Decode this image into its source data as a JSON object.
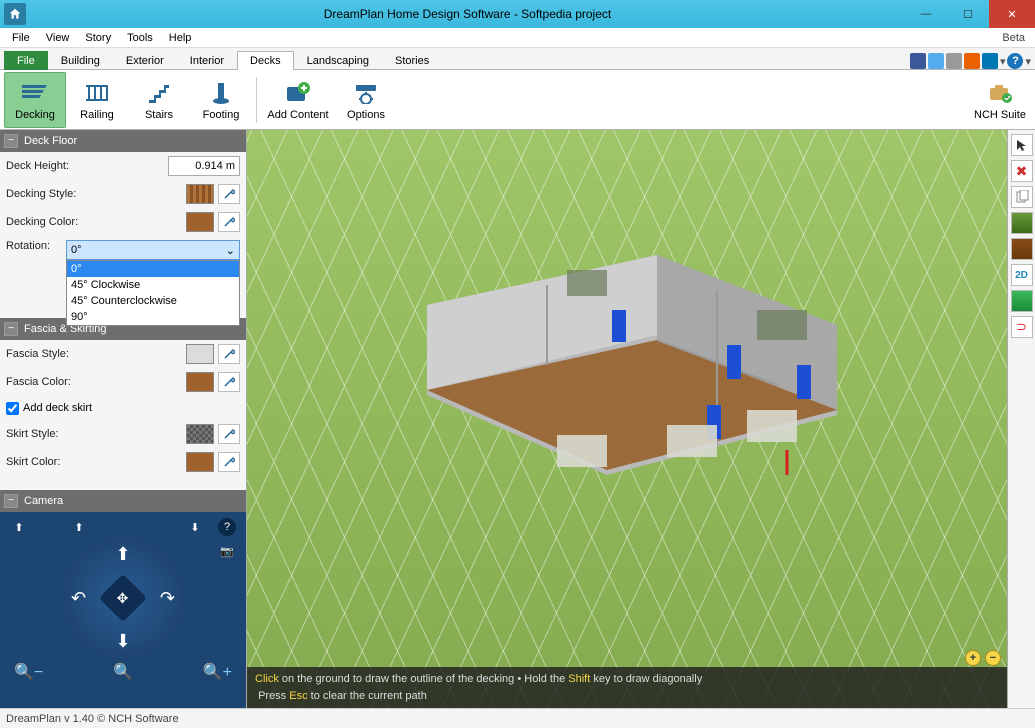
{
  "window": {
    "title": "DreamPlan Home Design Software - Softpedia project",
    "beta": "Beta"
  },
  "menu": [
    "File",
    "View",
    "Story",
    "Tools",
    "Help"
  ],
  "tabs": {
    "file": "File",
    "items": [
      "Building",
      "Exterior",
      "Interior",
      "Decks",
      "Landscaping",
      "Stories"
    ],
    "active": "Decks"
  },
  "ribbon": {
    "group1": [
      {
        "label": "Decking",
        "active": true
      },
      {
        "label": "Railing"
      },
      {
        "label": "Stairs"
      },
      {
        "label": "Footing"
      }
    ],
    "group2": [
      {
        "label": "Add Content"
      },
      {
        "label": "Options"
      }
    ],
    "right": {
      "label": "NCH Suite"
    }
  },
  "deck_floor": {
    "header": "Deck Floor",
    "height_label": "Deck Height:",
    "height_value": "0.914 m",
    "style_label": "Decking Style:",
    "color_label": "Decking Color:",
    "rotation_label": "Rotation:",
    "rotation_value": "0°",
    "rotation_options": [
      "0°",
      "45° Clockwise",
      "45° Counterclockwise",
      "90°"
    ]
  },
  "fascia": {
    "header": "Fascia & Skirting",
    "fstyle": "Fascia Style:",
    "fcolor": "Fascia Color:",
    "add_skirt": "Add deck skirt",
    "sstyle": "Skirt Style:",
    "scolor": "Skirt Color:"
  },
  "camera": {
    "header": "Camera"
  },
  "hint": {
    "click": "Click",
    "l1": " on the ground to draw the outline of the decking  •  Hold the ",
    "shift": "Shift",
    "l1b": " key to draw diagonally",
    "l2a": "Press ",
    "esc": "Esc",
    "l2b": " to clear the current path"
  },
  "tools_right": [
    "cursor",
    "delete",
    "copy",
    "terrain",
    "roof",
    "2D",
    "3d",
    "magnet"
  ],
  "status": "DreamPlan v 1.40 © NCH Software",
  "colors": {
    "deck_color": "#a0622d",
    "deck_style": "#c4803c",
    "fascia_style": "#d8d8d8",
    "fascia_color": "#a0622d",
    "skirt_style": "#6a6a6a",
    "skirt_color": "#a0622d"
  }
}
